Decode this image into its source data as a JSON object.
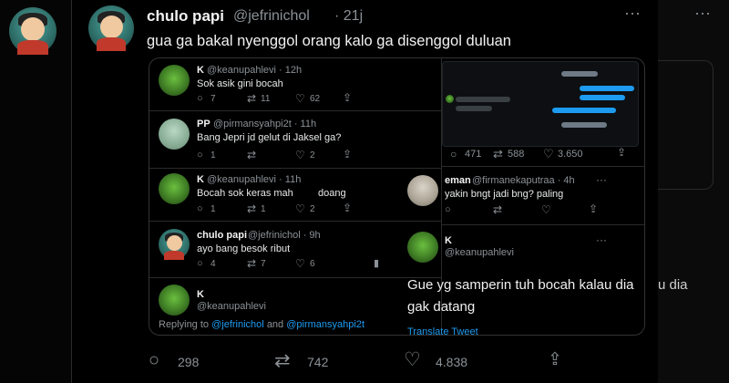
{
  "tweet": {
    "author": "chulo papi",
    "handle": "@jefrinichol",
    "time": "· 21j",
    "text": "gua ga bakal nyenggol orang kalo ga disenggol duluan",
    "more": "···",
    "stats": {
      "replies": "298",
      "retweets": "742",
      "likes": "4.838"
    }
  },
  "screenshot": {
    "left": [
      {
        "author": "K",
        "handle": "@keanupahlevi · 12h",
        "text": "Sok asik gini bocah",
        "counts": [
          "7",
          "11",
          "62"
        ]
      },
      {
        "author": "PP",
        "handle": "@pirmansyahpi2t · 11h",
        "text": "Bang Jepri jd gelut di Jaksel ga?",
        "counts": [
          "1",
          "",
          "2"
        ]
      },
      {
        "author": "K",
        "handle": "@keanupahlevi · 11h",
        "text": "Bocah sok keras mah",
        "text2": "doang",
        "counts": [
          "1",
          "1",
          "2"
        ]
      },
      {
        "author": "chulo papi",
        "handle": "@jefrinichol · 9h",
        "text": "ayo bang besok ribut",
        "counts": [
          "4",
          "7",
          "6"
        ]
      }
    ],
    "bottom_author": "K",
    "bottom_handle": "@keanupahlevi",
    "replying_prefix": "Replying to",
    "replying_user1": "@jefrinichol",
    "replying_and": "and",
    "replying_user2": "@pirmansyahpi2t",
    "right": {
      "top_counts": [
        "471",
        "588",
        "3.650"
      ],
      "eman_author": "eman",
      "eman_handle": "@firmanekaputraa · 4h",
      "eman_text": "yakin bngt jadi bng? paling",
      "k_author": "K",
      "k_handle": "@keanupahlevi",
      "big_text_line1": "Gue yg samperin tuh bocah kalau dia",
      "big_text_line2": "gak datang",
      "translate": "Translate Tweet"
    }
  },
  "right_strip": {
    "text": "u dia"
  }
}
